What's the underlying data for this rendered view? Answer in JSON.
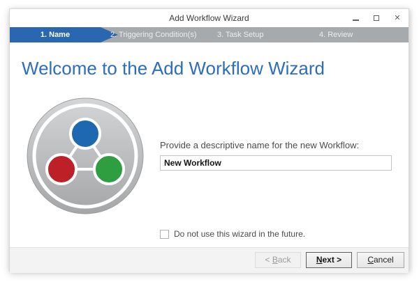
{
  "window": {
    "title": "Add Workflow Wizard",
    "icons": {
      "minimize": "horizontal-bar",
      "maximize": "square-outline",
      "close_glyph": "✕"
    }
  },
  "steps": {
    "items": [
      {
        "label": "1. Name",
        "active": true
      },
      {
        "label": "2. Triggering Condition(s)",
        "active": false
      },
      {
        "label": "3. Task Setup",
        "active": false
      },
      {
        "label": "4. Review",
        "active": false
      }
    ]
  },
  "content": {
    "heading": "Welcome to the Add Workflow Wizard",
    "name_label": "Provide a descriptive name for the new Workflow:",
    "name_value": "New Workflow",
    "checkbox_label": "Do not use this wizard in the future.",
    "checkbox_checked": false
  },
  "footer": {
    "back": {
      "pre": "< ",
      "mnemonic": "B",
      "rest": "ack",
      "enabled": false
    },
    "next": {
      "pre": "",
      "mnemonic": "N",
      "rest": "ext >",
      "enabled": true
    },
    "cancel": {
      "pre": "",
      "mnemonic": "C",
      "rest": "ancel",
      "enabled": true
    }
  },
  "colors": {
    "accent_blue": "#2968b0",
    "heading_blue": "#2d6dbe",
    "step_gray": "#a7aaac",
    "logo_blue": "#1e68b2",
    "logo_red": "#bd2027",
    "logo_green": "#2f9e41",
    "footer_gray": "#f3f3f3"
  }
}
